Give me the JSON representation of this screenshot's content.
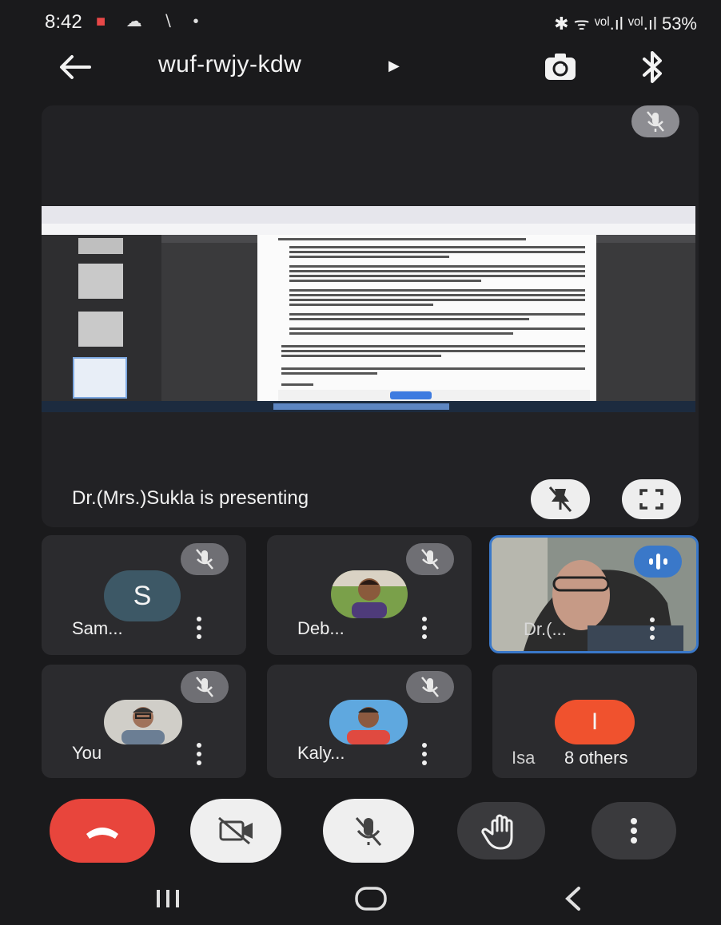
{
  "status_bar": {
    "time": "8:42",
    "right": "✱ ᯤ ᵛᵒˡ.ıl ᵛᵒˡ.ıl 53%",
    "battery": "53%"
  },
  "meeting": {
    "code": "wuf-rwjy-kdw",
    "presenting_text": "Dr.(Mrs.)Sukla is presenting"
  },
  "participants": [
    {
      "name": "Sam...",
      "avatar_letter": "S",
      "muted": true
    },
    {
      "name": "Deb...",
      "muted": true
    },
    {
      "name": "Dr.(...",
      "muted": false,
      "speaking": true
    },
    {
      "name": "You",
      "muted": true
    },
    {
      "name": "Kaly...",
      "muted": true
    },
    {
      "name": "Isa",
      "others": "8 others",
      "avatar_letter": "I"
    }
  ],
  "controls": [
    "end-call",
    "camera-off",
    "microphone-off",
    "raise-hand",
    "more-options"
  ],
  "colors": {
    "end_call": "#e8453c",
    "avatar_s": "#3d5866",
    "avatar_i": "#f0522e",
    "speaking_border": "#3a78c9",
    "background": "#1a1a1c"
  }
}
